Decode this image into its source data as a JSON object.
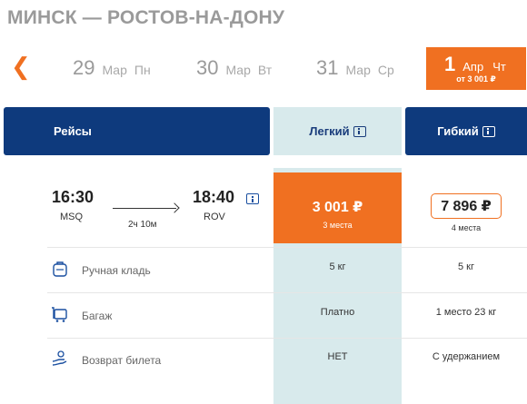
{
  "route": {
    "title": "МИНСК — РОСТОВ-НА-ДОНУ"
  },
  "dates": [
    {
      "day": "29",
      "month": "Мар",
      "weekday": "Пн"
    },
    {
      "day": "30",
      "month": "Мар",
      "weekday": "Вт"
    },
    {
      "day": "31",
      "month": "Мар",
      "weekday": "Ср"
    }
  ],
  "active_date": {
    "day": "1",
    "month": "Апр",
    "weekday": "Чт",
    "price": "от 3 001 ₽"
  },
  "headers": {
    "flights": "Рейсы",
    "light": "Легкий",
    "flexible": "Гибкий"
  },
  "flight": {
    "depart_time": "16:30",
    "depart_code": "MSQ",
    "arrive_time": "18:40",
    "arrive_code": "ROV",
    "duration": "2ч 10м"
  },
  "fares": {
    "light": {
      "price": "3 001 ₽",
      "seats": "3 места"
    },
    "flexible": {
      "price": "7 896 ₽",
      "seats": "4 места"
    }
  },
  "features": [
    {
      "icon": "hand-luggage-icon",
      "label": "Ручная кладь",
      "light": "5 кг",
      "flexible": "5 кг"
    },
    {
      "icon": "baggage-icon",
      "label": "Багаж",
      "light": "Платно",
      "flexible": "1 место 23 кг"
    },
    {
      "icon": "refund-icon",
      "label": "Возврат билета",
      "light": "НЕТ",
      "flexible": "С удержанием"
    }
  ],
  "colors": {
    "accent": "#f07021",
    "navy": "#0e3a7d",
    "light_fare_bg": "#d8eaec"
  }
}
